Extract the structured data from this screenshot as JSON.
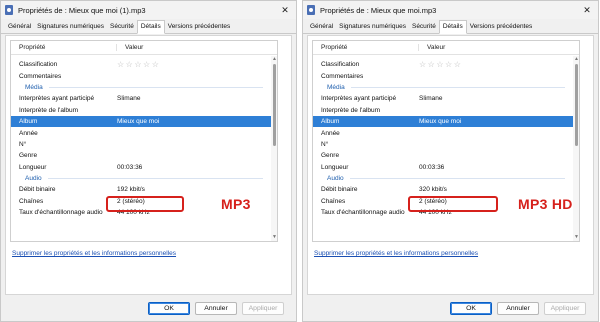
{
  "dialogs": [
    {
      "title": "Propriétés de : Mieux que moi (1).mp3",
      "tabs": [
        "Général",
        "Signatures numériques",
        "Sécurité",
        "Détails",
        "Versions précédentes"
      ],
      "active_tab": "Détails",
      "columns": [
        "Propriété",
        "Valeur"
      ],
      "rows": {
        "classification": "Classification",
        "commentaires": "Commentaires",
        "media_section": "Média",
        "interpretes": "Interprètes ayant participé",
        "interpretes_val": "Slimane",
        "interprete_album": "Interprète de l'album",
        "album": "Album",
        "album_val": "Mieux que moi",
        "annee": "Année",
        "numero": "N°",
        "genre": "Genre",
        "longueur": "Longueur",
        "longueur_val": "00:03:36",
        "audio_section": "Audio",
        "debit": "Débit binaire",
        "debit_val": "192 kbit/s",
        "chaines": "Chaînes",
        "chaines_val": "2 (stéréo)",
        "taux": "Taux d'échantillonnage audio",
        "taux_val": "44 100 kHz"
      },
      "rating_stars": "☆☆☆☆☆",
      "remove_link": "Supprimer les propriétés et les informations personnelles",
      "buttons": {
        "ok": "OK",
        "cancel": "Annuler",
        "apply": "Appliquer"
      },
      "tag": "MP3"
    },
    {
      "title": "Propriétés de : Mieux que moi.mp3",
      "tabs": [
        "Général",
        "Signatures numériques",
        "Sécurité",
        "Détails",
        "Versions précédentes"
      ],
      "active_tab": "Détails",
      "columns": [
        "Propriété",
        "Valeur"
      ],
      "rows": {
        "classification": "Classification",
        "commentaires": "Commentaires",
        "media_section": "Média",
        "interpretes": "Interprètes ayant participé",
        "interpretes_val": "Slimane",
        "interprete_album": "Interprète de l'album",
        "album": "Album",
        "album_val": "Mieux que moi",
        "annee": "Année",
        "numero": "N°",
        "genre": "Genre",
        "longueur": "Longueur",
        "longueur_val": "00:03:36",
        "audio_section": "Audio",
        "debit": "Débit binaire",
        "debit_val": "320 kbit/s",
        "chaines": "Chaînes",
        "chaines_val": "2 (stéréo)",
        "taux": "Taux d'échantillonnage audio",
        "taux_val": "44 100 kHz"
      },
      "rating_stars": "☆☆☆☆☆",
      "remove_link": "Supprimer les propriétés et les informations personnelles",
      "buttons": {
        "ok": "OK",
        "cancel": "Annuler",
        "apply": "Appliquer"
      },
      "tag": "MP3 HD"
    }
  ],
  "colors": {
    "selection": "#2e7fd6",
    "highlight": "#d6211c",
    "section": "#1f5fae",
    "link": "#1a4fb3"
  },
  "icons": {
    "file": "mp3-file-icon",
    "close": "close-icon",
    "scroll_up": "chevron-up-icon",
    "scroll_down": "chevron-down-icon"
  }
}
